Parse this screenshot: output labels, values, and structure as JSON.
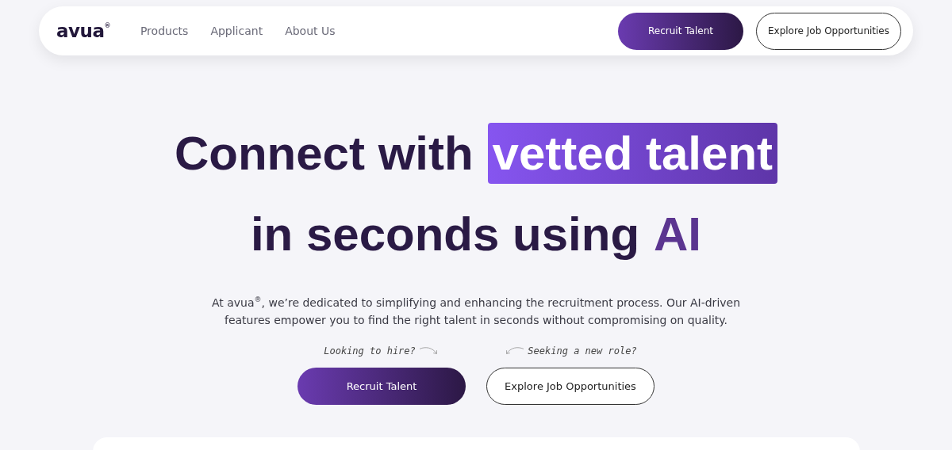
{
  "nav": {
    "logo": "avua",
    "logo_mark": "®",
    "links": [
      {
        "label": "Products"
      },
      {
        "label": "Applicant"
      },
      {
        "label": "About Us"
      }
    ],
    "buttons": [
      {
        "label": "Recruit Talent",
        "kind": "primary"
      },
      {
        "label": "Explore Job Opportunities",
        "kind": "outline"
      }
    ]
  },
  "hero": {
    "headline": [
      [
        {
          "text": "Connect with",
          "kind": "plain"
        },
        {
          "text": "vetted talent",
          "kind": "highlight"
        }
      ],
      [
        {
          "text": "in seconds using",
          "kind": "plain"
        },
        {
          "text": "AI",
          "kind": "accent"
        }
      ]
    ],
    "description": "At avua$^{®}$, we’re dedicated to simplifying and enhancing the recruitment process. Our AI-driven features empower you to find the right talent in seconds without compromising on quality.",
    "actions": [
      {
        "note": "Looking to hire?",
        "label": "Recruit Talent",
        "kind": "primary"
      },
      {
        "note": "Seeking a new role?",
        "label": "Explore Job Opportunities",
        "kind": "outline"
      }
    ]
  }
}
